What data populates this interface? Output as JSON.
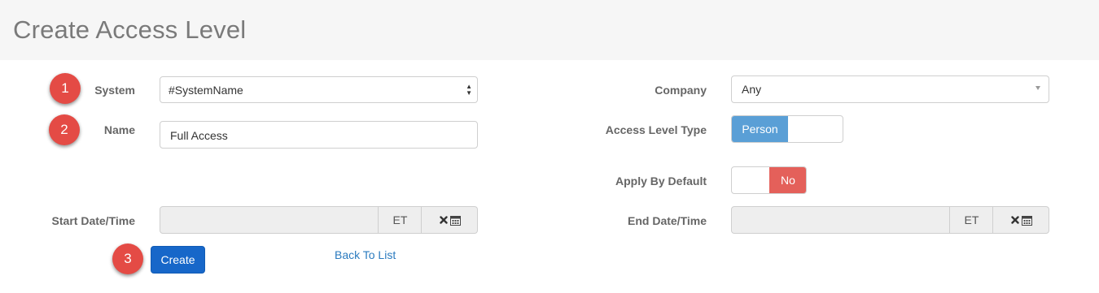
{
  "page": {
    "title": "Create Access Level"
  },
  "markers": [
    "1",
    "2",
    "3"
  ],
  "form": {
    "system": {
      "label": "System",
      "value": "#SystemName"
    },
    "name": {
      "label": "Name",
      "value": "Full Access"
    },
    "company": {
      "label": "Company",
      "value": "Any"
    },
    "access_level_type": {
      "label": "Access Level Type",
      "selected": "Person",
      "color": "#5a9fd6"
    },
    "apply_by_default": {
      "label": "Apply By Default",
      "selected": "No",
      "color": "#e4605a"
    },
    "start": {
      "label": "Start Date/Time",
      "value": "",
      "tz": "ET"
    },
    "end": {
      "label": "End Date/Time",
      "value": "",
      "tz": "ET"
    }
  },
  "actions": {
    "create_label": "Create",
    "back_label": "Back To List"
  },
  "icons": [
    "clear-icon",
    "calendar-icon",
    "sort-arrows-icon",
    "dropdown-caret-icon"
  ]
}
